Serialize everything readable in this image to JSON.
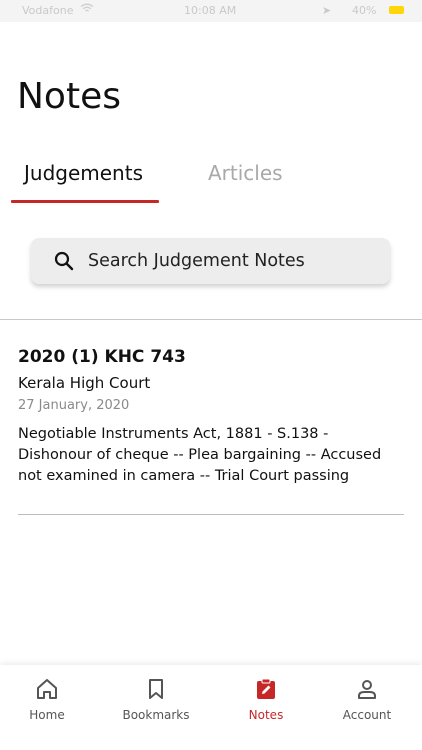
{
  "status_bar": {
    "carrier": "Vodafone",
    "time": "10:08 AM",
    "battery": "40%",
    "battery_color": "#ffd60a"
  },
  "page": {
    "title": "Notes"
  },
  "tabs": [
    {
      "label": "Judgements",
      "active": true
    },
    {
      "label": "Articles",
      "active": false
    }
  ],
  "search": {
    "placeholder": "Search Judgement Notes",
    "value": "",
    "icon": "search-icon"
  },
  "notes": [
    {
      "citation": "2020 (1) KHC 743",
      "court": "Kerala High Court",
      "date": "27 January, 2020",
      "summary": "Negotiable Instruments Act, 1881 - S.138 - Dishonour of cheque -- Plea bargaining -- Accused not examined in camera -- Trial Court passing"
    }
  ],
  "bottom_nav": [
    {
      "label": "Home",
      "icon": "home-icon",
      "active": false
    },
    {
      "label": "Bookmarks",
      "icon": "bookmark-icon",
      "active": false
    },
    {
      "label": "Notes",
      "icon": "notes-clipboard-icon",
      "active": true
    },
    {
      "label": "Account",
      "icon": "account-icon",
      "active": false
    }
  ],
  "colors": {
    "accent": "#c62828",
    "inactive_tab": "#a9a9a9",
    "date": "#8a8a8a"
  }
}
